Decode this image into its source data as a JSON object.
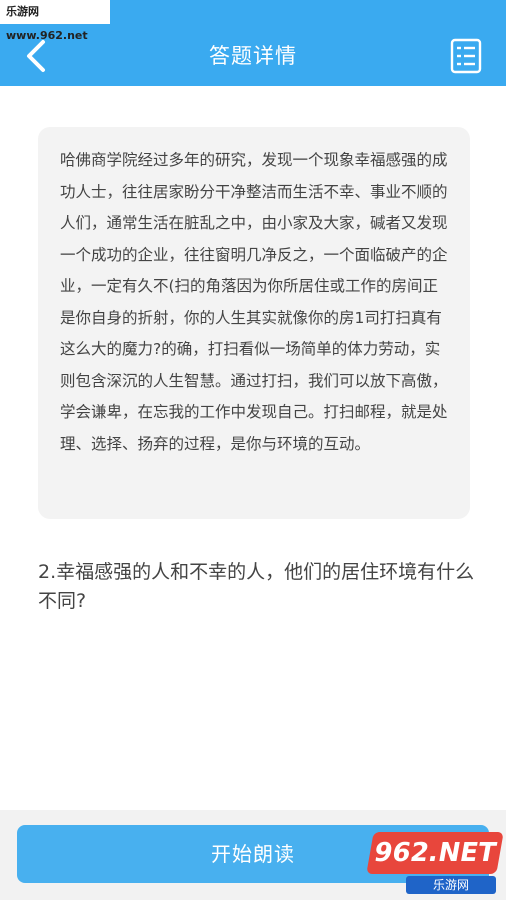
{
  "watermark_top": "乐游网 www.962.net",
  "header": {
    "title": "答题详情",
    "back_icon": "chevron-left-icon",
    "list_icon": "document-list-icon",
    "bg_color": "#3aaaf0"
  },
  "passage": {
    "text": "哈佛商学院经过多年的研究，发现一个现象幸福感强的成功人士，往往居家盼分干净整洁而生活不幸、事业不顺的人们，通常生活在脏乱之中，由小家及大家，碱者又发现一个成功的企业，往往窗明几净反之，一个面临破产的企业，一定有久不(扫的角落因为你所居住或工作的房间正是你自身的折射，你的人生其实就像你的房1司打扫真有这么大的魔力?的确，打扫看似一场简单的体力劳动，实则包含深沉的人生智慧。通过打扫，我们可以放下高傲，学会谦卑，在忘我的工作中发现自己。打扫邮程，就是处理、选择、扬弃的过程，是你与环境的互动。"
  },
  "question": {
    "text": "2.幸福感强的人和不幸的人，他们的居住环境有什么不同?"
  },
  "footer": {
    "read_button_label": "开始朗读",
    "button_color": "#48b0ef"
  },
  "watermark_br": {
    "badge": "962.NET",
    "sub": "乐游网"
  }
}
